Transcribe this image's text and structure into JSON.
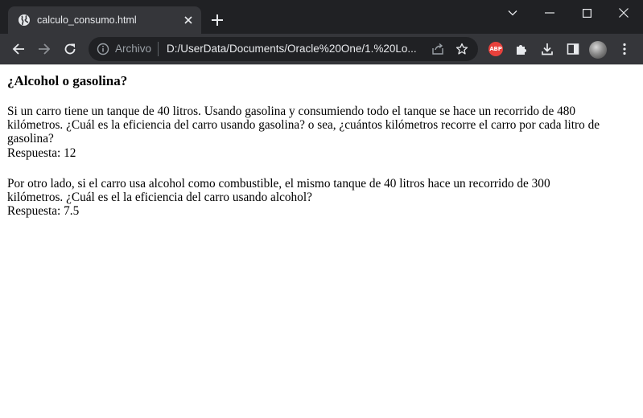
{
  "browser": {
    "tab": {
      "title": "calculo_consumo.html",
      "favicon": "globe-icon"
    },
    "address_bar": {
      "security_chip": "Archivo",
      "url": "D:/UserData/Documents/Oracle%20One/1.%20Lo..."
    },
    "extensions": {
      "adblock_label": "ABP"
    }
  },
  "page": {
    "heading": "¿Alcohol o gasolina?",
    "paragraph1": {
      "line1": "Si un carro tiene un tanque de 40 litros. Usando gasolina y consumiendo todo el tanque se hace un recorrido de 480",
      "line2": "kilómetros. ¿Cuál es la eficiencia del carro usando gasolina? o sea, ¿cuántos kilómetros recorre el carro por cada litro de",
      "line3": "gasolina?",
      "answer": "Respuesta: 12"
    },
    "paragraph2": {
      "line1": "Por otro lado, si el carro usa alcohol como combustible, el mismo tanque de 40 litros hace un recorrido de 300",
      "line2": "kilómetros. ¿Cuál es el la eficiencia del carro usando alcohol?",
      "answer": "Respuesta: 7.5"
    }
  }
}
